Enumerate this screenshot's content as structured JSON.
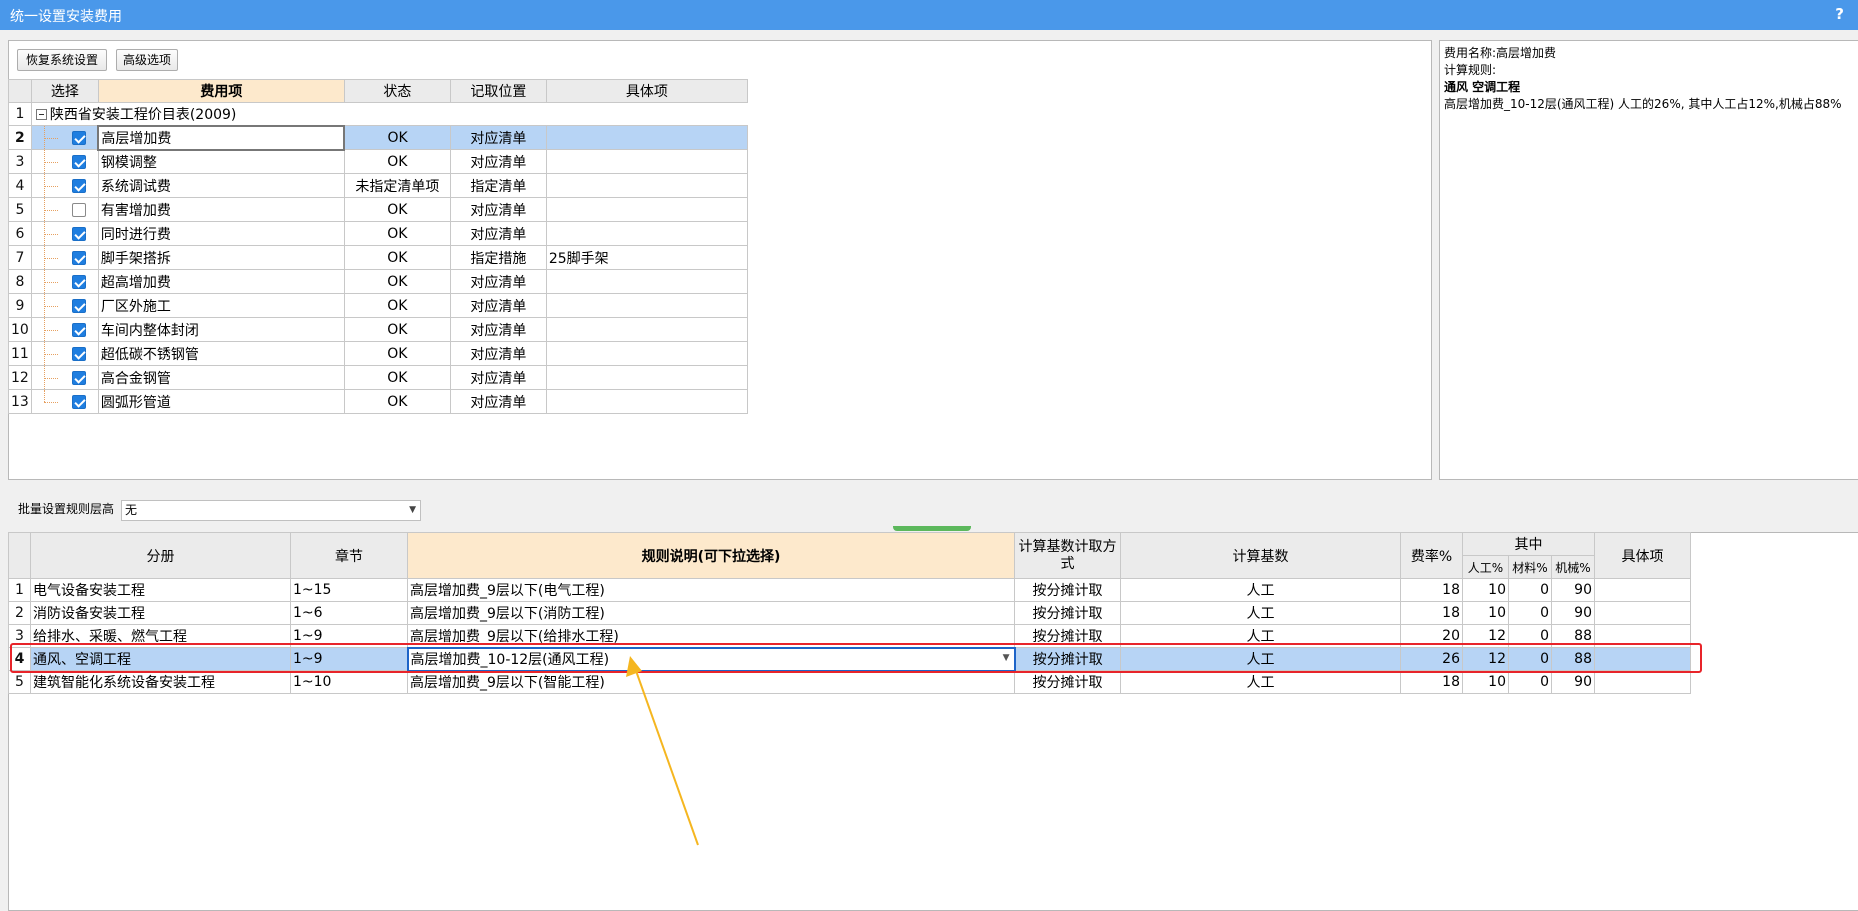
{
  "window": {
    "title": "统一设置安装费用",
    "help": "?"
  },
  "toolbar": {
    "restore": "恢复系统设置",
    "advanced": "高级选项"
  },
  "fee_table": {
    "headers": {
      "select": "选择",
      "fee_item": "费用项",
      "status": "状态",
      "position": "记取位置",
      "specific": "具体项"
    },
    "group": {
      "num": "1",
      "name": "陕西省安装工程价目表(2009)"
    },
    "rows": [
      {
        "num": "2",
        "checked": true,
        "name": "高层增加费",
        "status": "OK",
        "position": "对应清单",
        "specific": ""
      },
      {
        "num": "3",
        "checked": true,
        "name": "钢模调整",
        "status": "OK",
        "position": "对应清单",
        "specific": ""
      },
      {
        "num": "4",
        "checked": true,
        "name": "系统调试费",
        "status": "未指定清单项",
        "position": "指定清单",
        "specific": ""
      },
      {
        "num": "5",
        "checked": false,
        "name": "有害增加费",
        "status": "OK",
        "position": "对应清单",
        "specific": ""
      },
      {
        "num": "6",
        "checked": true,
        "name": "同时进行费",
        "status": "OK",
        "position": "对应清单",
        "specific": ""
      },
      {
        "num": "7",
        "checked": true,
        "name": "脚手架搭拆",
        "status": "OK",
        "position": "指定措施",
        "specific": "25脚手架"
      },
      {
        "num": "8",
        "checked": true,
        "name": "超高增加费",
        "status": "OK",
        "position": "对应清单",
        "specific": ""
      },
      {
        "num": "9",
        "checked": true,
        "name": "厂区外施工",
        "status": "OK",
        "position": "对应清单",
        "specific": ""
      },
      {
        "num": "10",
        "checked": true,
        "name": "车间内整体封闭",
        "status": "OK",
        "position": "对应清单",
        "specific": ""
      },
      {
        "num": "11",
        "checked": true,
        "name": "超低碳不锈钢管",
        "status": "OK",
        "position": "对应清单",
        "specific": ""
      },
      {
        "num": "12",
        "checked": true,
        "name": "高合金钢管",
        "status": "OK",
        "position": "对应清单",
        "specific": ""
      },
      {
        "num": "13",
        "checked": true,
        "name": "圆弧形管道",
        "status": "OK",
        "position": "对应清单",
        "specific": ""
      }
    ]
  },
  "info": {
    "fee_name": "费用名称:高层增加费",
    "rule_label": "计算规则:",
    "project": "通风 空调工程",
    "desc": "高层增加费_10-12层(通风工程) 人工的26%, 其中人工占12%,机械占88%"
  },
  "batch": {
    "label": "批量设置规则层高",
    "value": "无"
  },
  "rule_table": {
    "headers": {
      "volume": "分册",
      "chapter": "章节",
      "rule": "规则说明(可下拉选择)",
      "method": "计算基数计取方式",
      "base": "计算基数",
      "rate": "费率%",
      "among": "其中",
      "labor": "人工%",
      "material": "材料%",
      "machine": "机械%",
      "specific": "具体项"
    },
    "rows": [
      {
        "num": "1",
        "volume": "电气设备安装工程",
        "chapter": "1~15",
        "rule": "高层增加费_9层以下(电气工程)",
        "method": "按分摊计取",
        "base": "人工",
        "rate": "18",
        "labor": "10",
        "material": "0",
        "machine": "90",
        "specific": ""
      },
      {
        "num": "2",
        "volume": "消防设备安装工程",
        "chapter": "1~6",
        "rule": "高层增加费_9层以下(消防工程)",
        "method": "按分摊计取",
        "base": "人工",
        "rate": "18",
        "labor": "10",
        "material": "0",
        "machine": "90",
        "specific": ""
      },
      {
        "num": "3",
        "volume": "给排水、采暖、燃气工程",
        "chapter": "1~9",
        "rule": "高层增加费_9层以下(给排水工程)",
        "method": "按分摊计取",
        "base": "人工",
        "rate": "20",
        "labor": "12",
        "material": "0",
        "machine": "88",
        "specific": ""
      },
      {
        "num": "4",
        "volume": "通风、空调工程",
        "chapter": "1~9",
        "rule": "高层增加费_10-12层(通风工程)",
        "method": "按分摊计取",
        "base": "人工",
        "rate": "26",
        "labor": "12",
        "material": "0",
        "machine": "88",
        "specific": ""
      },
      {
        "num": "5",
        "volume": "建筑智能化系统设备安装工程",
        "chapter": "1~10",
        "rule": "高层增加费_9层以下(智能工程)",
        "method": "按分摊计取",
        "base": "人工",
        "rate": "18",
        "labor": "10",
        "material": "0",
        "machine": "90",
        "specific": ""
      }
    ]
  },
  "colors": {
    "titlebar": "#4a98ea",
    "selection": "#b7d4f5",
    "highlight_header": "#fde9cc",
    "annotation_red": "#e8242a",
    "arrow": "#f5b620"
  }
}
